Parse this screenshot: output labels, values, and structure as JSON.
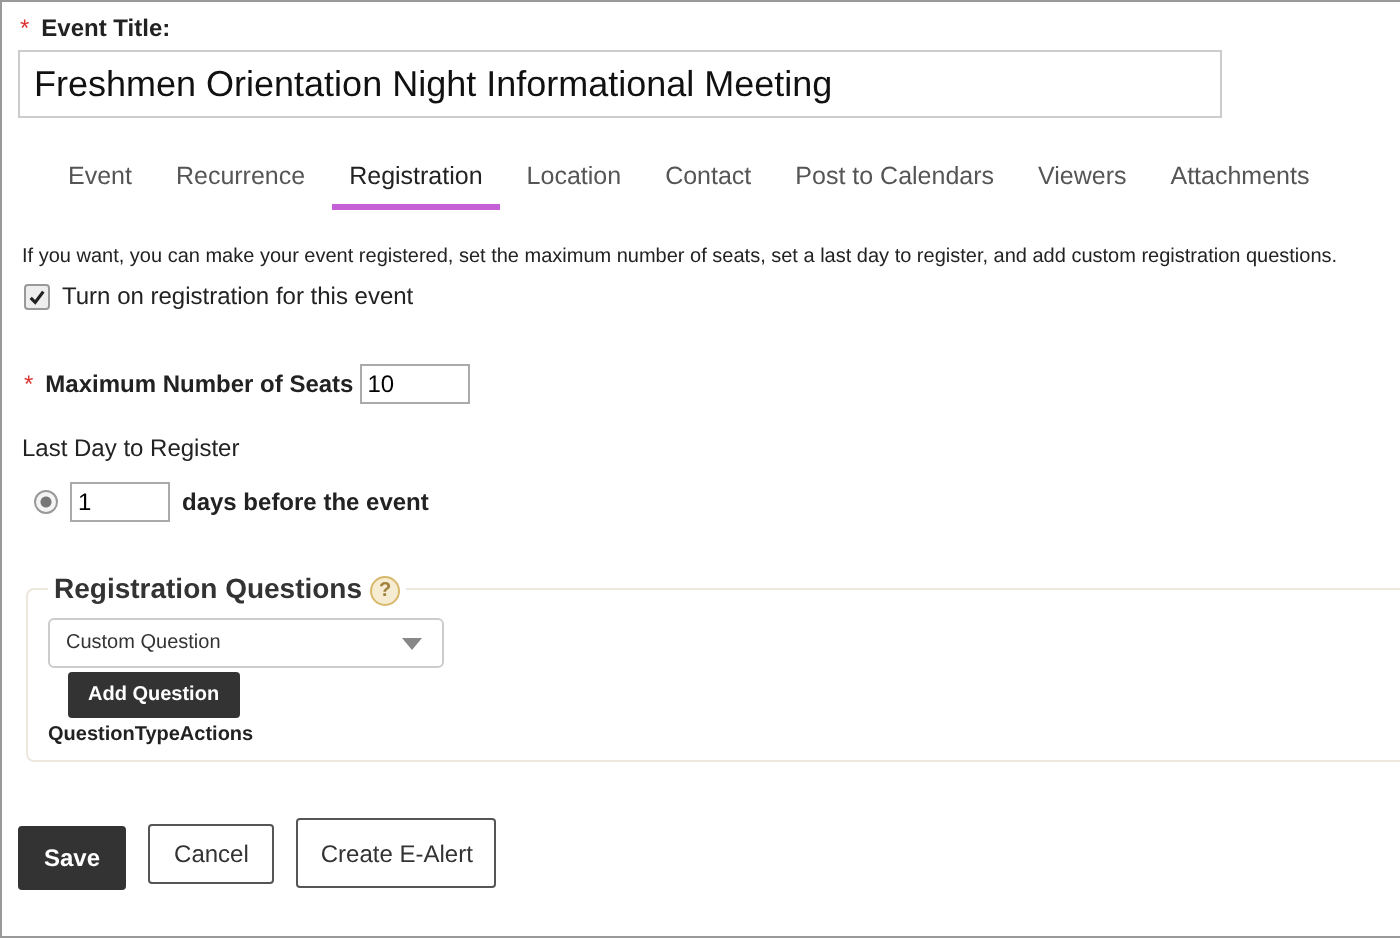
{
  "event_title": {
    "required_mark": "*",
    "label": "Event Title:",
    "value": "Freshmen Orientation Night Informational Meeting"
  },
  "tabs": [
    {
      "label": "Event",
      "selected": false
    },
    {
      "label": "Recurrence",
      "selected": false
    },
    {
      "label": "Registration",
      "selected": true
    },
    {
      "label": "Location",
      "selected": false
    },
    {
      "label": "Contact",
      "selected": false
    },
    {
      "label": "Post to Calendars",
      "selected": false
    },
    {
      "label": "Viewers",
      "selected": false
    },
    {
      "label": "Attachments",
      "selected": false
    }
  ],
  "intro": "If you want, you can make your event registered, set the maximum number of seats, set a last day to register, and add custom registration questions.",
  "registration_toggle": {
    "label": "Turn on registration for this event",
    "checked": true
  },
  "max_seats": {
    "required_mark": "*",
    "label": "Maximum Number of Seats",
    "value": "10"
  },
  "last_day": {
    "label": "Last Day to Register",
    "selected": true,
    "value": "1",
    "suffix": "days before the event"
  },
  "questions": {
    "legend": "Registration Questions",
    "help": "?",
    "select": "Custom Question",
    "add_button": "Add Question",
    "actions_label": "QuestionTypeActions"
  },
  "buttons": [
    {
      "label": "Save",
      "kind": "primary"
    },
    {
      "label": "Cancel",
      "kind": "secondary"
    },
    {
      "label": "Create E-Alert",
      "kind": "secondary"
    }
  ]
}
